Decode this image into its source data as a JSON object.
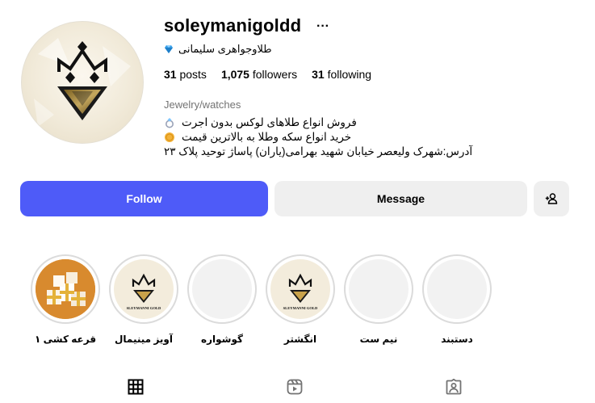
{
  "profile": {
    "username": "soleymanigoldd",
    "more_icon": "more-horizontal-icon",
    "full_name": "طلاوجواهری سلیمانی",
    "badge_icon": "blue-diamond-icon",
    "avatar_alt": "profile-picture",
    "avatar_logo_text": ""
  },
  "stats": {
    "posts_count": "31",
    "posts_label": "posts",
    "followers_count": "1,075",
    "followers_label": "followers",
    "following_count": "31",
    "following_label": "following"
  },
  "bio": {
    "category": "Jewelry/watches",
    "line1": "فروش انواع طلاهای لوکس بدون اجرت",
    "line1_icon": "ring-icon",
    "line2": "خرید انواع سکه وطلا به بالاترین قیمت",
    "line2_icon": "coin-icon",
    "line3": "آدرس:شهرک ولیعصر خیابان شهید بهرامی(یاران) پاساژ توحید پلاک ۲۳"
  },
  "actions": {
    "follow_label": "Follow",
    "message_label": "Message",
    "add_user_icon": "add-person-icon"
  },
  "highlights": [
    {
      "label": "قرعه کشی ۱",
      "thumb": "gift-boxes"
    },
    {
      "label": "آویز مینیمال",
      "thumb": "crown-logo"
    },
    {
      "label": "گوشواره",
      "thumb": "empty"
    },
    {
      "label": "انگشتر",
      "thumb": "crown-logo"
    },
    {
      "label": "نیم ست",
      "thumb": "empty"
    },
    {
      "label": "دستبند",
      "thumb": "empty"
    }
  ],
  "highlight_logo_text": "SLEYMANNI GOLD",
  "tabs": [
    {
      "name": "posts",
      "icon": "grid-icon",
      "active": true
    },
    {
      "name": "reels",
      "icon": "reels-icon",
      "active": false
    },
    {
      "name": "tagged",
      "icon": "tagged-icon",
      "active": false
    }
  ],
  "colors": {
    "follow_button": "#4e5bf8",
    "secondary_button": "#efefef",
    "muted_text": "#737373",
    "gold": "#c9a24a"
  }
}
